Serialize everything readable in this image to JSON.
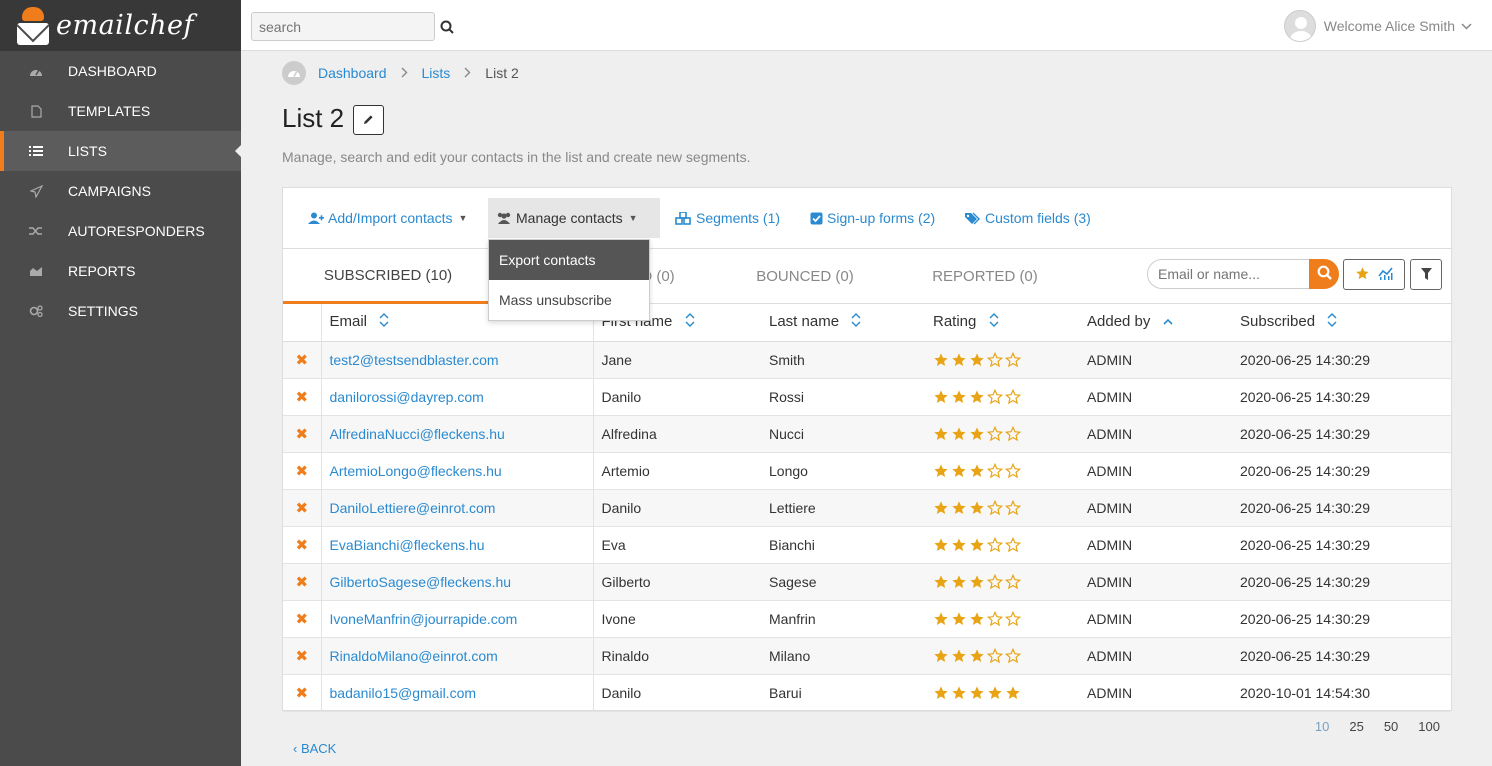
{
  "brand": {
    "name": "emailchef"
  },
  "sidebar": {
    "items": [
      {
        "label": "DASHBOARD",
        "icon": "dashboard-icon"
      },
      {
        "label": "TEMPLATES",
        "icon": "file-icon"
      },
      {
        "label": "LISTS",
        "icon": "list-icon",
        "active": true
      },
      {
        "label": "CAMPAIGNS",
        "icon": "paper-plane-icon"
      },
      {
        "label": "AUTORESPONDERS",
        "icon": "shuffle-icon"
      },
      {
        "label": "REPORTS",
        "icon": "area-chart-icon"
      },
      {
        "label": "SETTINGS",
        "icon": "gears-icon"
      }
    ]
  },
  "topbar": {
    "search_placeholder": "search",
    "welcome": "Welcome Alice Smith"
  },
  "breadcrumb": {
    "home": "Dashboard",
    "lists": "Lists",
    "current": "List 2"
  },
  "page": {
    "title": "List 2",
    "subtitle": "Manage, search and edit your contacts in the list and create new segments."
  },
  "toolbar": {
    "add_import": "Add/Import contacts",
    "manage": "Manage contacts",
    "segments": "Segments (1)",
    "signup_forms": "Sign-up forms (2)",
    "custom_fields": "Custom fields (3)"
  },
  "dropdown": {
    "export": "Export contacts",
    "mass_unsubscribe": "Mass unsubscribe"
  },
  "tabs": {
    "subscribed": "SUBSCRIBED (10)",
    "unsubscribed_partial": "D (0)",
    "bounced": "BOUNCED (0)",
    "reported": "REPORTED (0)",
    "search_placeholder": "Email or name..."
  },
  "table": {
    "headers": {
      "email": "Email",
      "first_name": "First name",
      "last_name": "Last name",
      "rating": "Rating",
      "added_by": "Added by",
      "subscribed": "Subscribed"
    },
    "rows": [
      {
        "email": "test2@testsendblaster.com",
        "first": "Jane",
        "last": "Smith",
        "rating": 3,
        "added_by": "ADMIN",
        "subscribed": "2020-06-25 14:30:29"
      },
      {
        "email": "danilorossi@dayrep.com",
        "first": "Danilo",
        "last": "Rossi",
        "rating": 3,
        "added_by": "ADMIN",
        "subscribed": "2020-06-25 14:30:29"
      },
      {
        "email": "AlfredinaNucci@fleckens.hu",
        "first": "Alfredina",
        "last": "Nucci",
        "rating": 3,
        "added_by": "ADMIN",
        "subscribed": "2020-06-25 14:30:29"
      },
      {
        "email": "ArtemioLongo@fleckens.hu",
        "first": "Artemio",
        "last": "Longo",
        "rating": 3,
        "added_by": "ADMIN",
        "subscribed": "2020-06-25 14:30:29"
      },
      {
        "email": "DaniloLettiere@einrot.com",
        "first": "Danilo",
        "last": "Lettiere",
        "rating": 3,
        "added_by": "ADMIN",
        "subscribed": "2020-06-25 14:30:29"
      },
      {
        "email": "EvaBianchi@fleckens.hu",
        "first": "Eva",
        "last": "Bianchi",
        "rating": 3,
        "added_by": "ADMIN",
        "subscribed": "2020-06-25 14:30:29"
      },
      {
        "email": "GilbertoSagese@fleckens.hu",
        "first": "Gilberto",
        "last": "Sagese",
        "rating": 3,
        "added_by": "ADMIN",
        "subscribed": "2020-06-25 14:30:29"
      },
      {
        "email": "IvoneManfrin@jourrapide.com",
        "first": "Ivone",
        "last": "Manfrin",
        "rating": 3,
        "added_by": "ADMIN",
        "subscribed": "2020-06-25 14:30:29"
      },
      {
        "email": "RinaldoMilano@einrot.com",
        "first": "Rinaldo",
        "last": "Milano",
        "rating": 3,
        "added_by": "ADMIN",
        "subscribed": "2020-06-25 14:30:29"
      },
      {
        "email": "badanilo15@gmail.com",
        "first": "Danilo",
        "last": "Barui",
        "rating": 5,
        "added_by": "ADMIN",
        "subscribed": "2020-10-01 14:54:30"
      }
    ]
  },
  "pagination": {
    "sizes": [
      "10",
      "25",
      "50",
      "100"
    ],
    "current": "10"
  },
  "back_label": "BACK",
  "colors": {
    "accent": "#f07d1b",
    "link": "#2a8ad0",
    "sidebar": "#4b4b4b",
    "star": "#e8a415"
  }
}
